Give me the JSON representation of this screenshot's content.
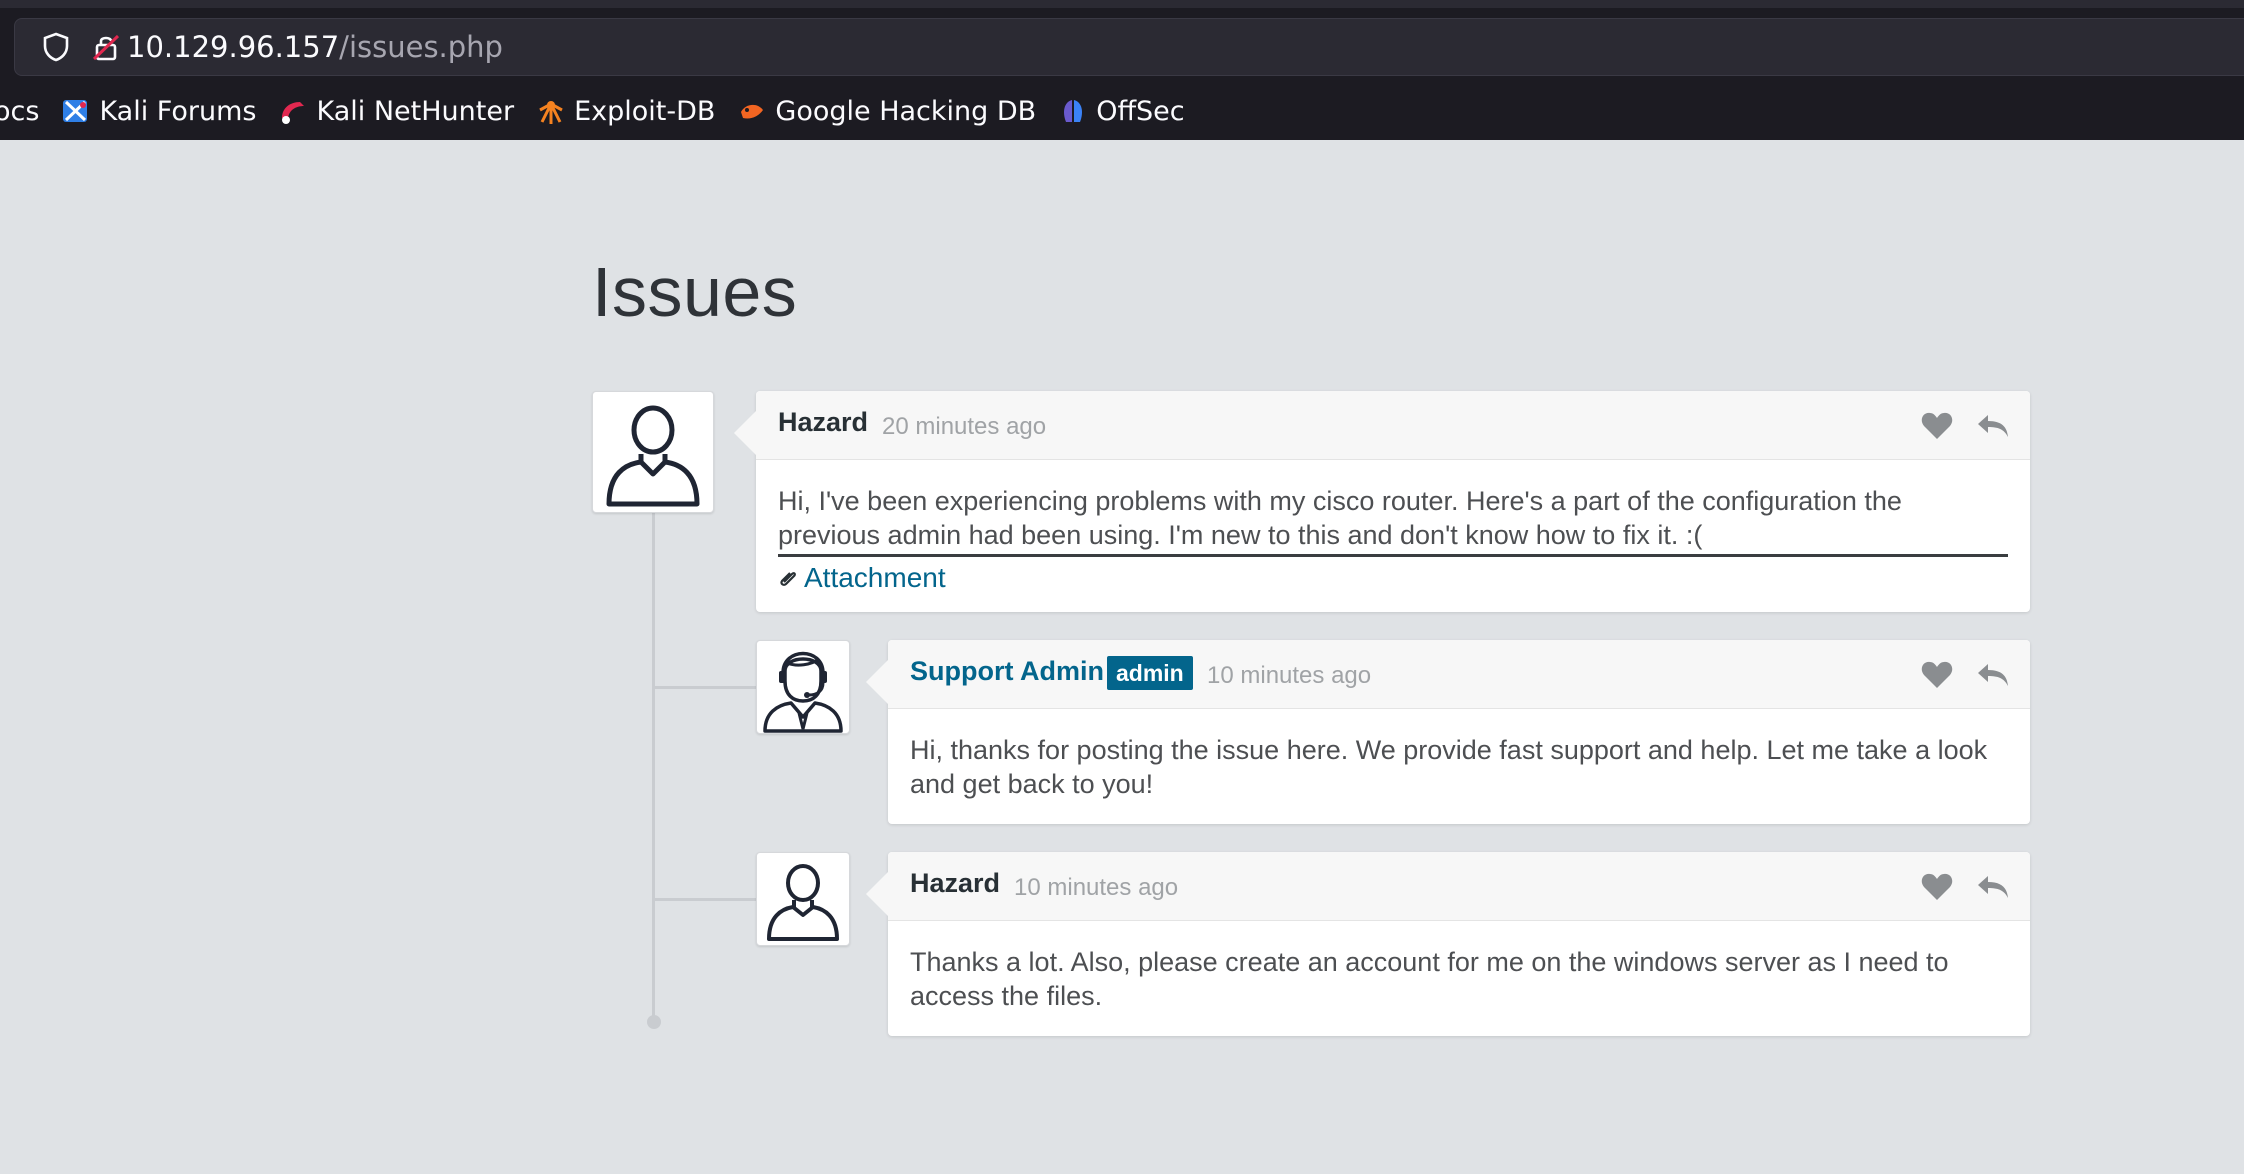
{
  "browser": {
    "url_host": "10.129.96.157",
    "url_path": "/issues.php",
    "bookmarks": [
      {
        "label": "ocs",
        "icon": "docs-icon"
      },
      {
        "label": "Kali Forums",
        "icon": "kali-forums-icon"
      },
      {
        "label": "Kali NetHunter",
        "icon": "nethunter-icon"
      },
      {
        "label": "Exploit-DB",
        "icon": "exploit-db-icon"
      },
      {
        "label": "Google Hacking DB",
        "icon": "ghdb-icon"
      },
      {
        "label": "OffSec",
        "icon": "offsec-icon"
      }
    ]
  },
  "page": {
    "title": "Issues"
  },
  "comments": [
    {
      "author": "Hazard",
      "time": "20 minutes ago",
      "body": "Hi, I've been experiencing problems with my cisco router. Here's a part of the configuration the previous admin had been using. I'm new to this and don't know how to fix it. :(",
      "attachment": "Attachment",
      "avatar": "user-avatar-icon"
    },
    {
      "author": "Support Admin",
      "badge": "admin",
      "time": "10 minutes ago",
      "body": "Hi, thanks for posting the issue here. We provide fast support and help. Let me take a look and get back to you!",
      "avatar": "support-agent-avatar-icon"
    },
    {
      "author": "Hazard",
      "time": "10 minutes ago",
      "body": "Thanks a lot. Also, please create an account for me on the windows server as I need to access the files.",
      "avatar": "user-avatar-icon"
    }
  ],
  "colors": {
    "page_bg": "#dfe2e5",
    "accent": "#03658c",
    "chrome_bg": "#1c1b22"
  }
}
